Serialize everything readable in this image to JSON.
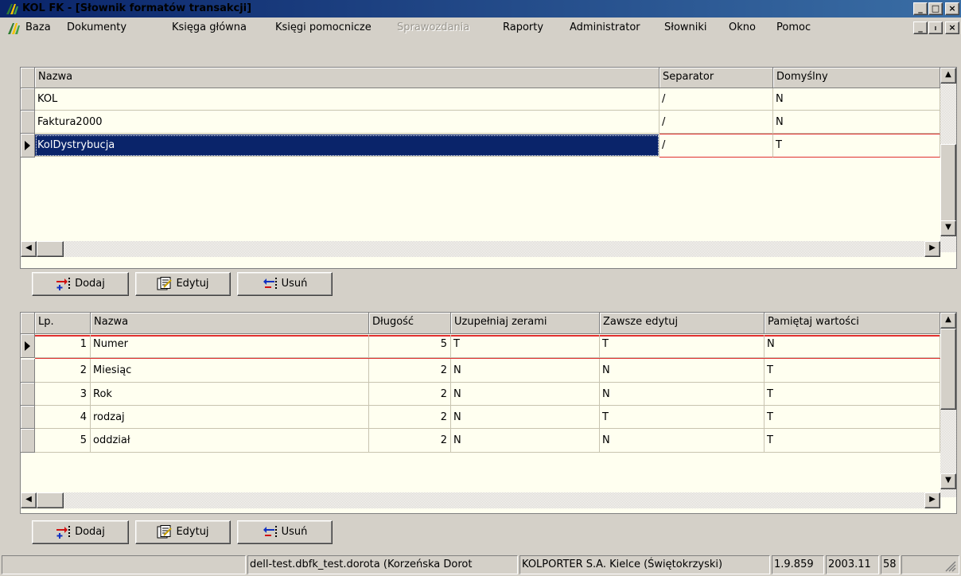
{
  "window": {
    "title": "KOL FK - [Słownik formatów transakcji]",
    "minimize": "_",
    "restore": "□",
    "close": "×"
  },
  "mdi": {
    "minimize": "_",
    "restore": "ₗ",
    "close": "×"
  },
  "menu": [
    {
      "label": "Baza",
      "enabled": true
    },
    {
      "label": "Dokumenty",
      "enabled": true
    },
    {
      "label": "Księga główna",
      "enabled": true
    },
    {
      "label": "Księgi pomocnicze",
      "enabled": true
    },
    {
      "label": "Sprawozdania",
      "enabled": false
    },
    {
      "label": "Raporty",
      "enabled": true
    },
    {
      "label": "Administrator",
      "enabled": true
    },
    {
      "label": "Słowniki",
      "enabled": true
    },
    {
      "label": "Okno",
      "enabled": true
    },
    {
      "label": "Pomoc",
      "enabled": true
    }
  ],
  "formats": {
    "columns": [
      "Nazwa",
      "Separator",
      "Domyślny"
    ],
    "rows": [
      [
        "KOL",
        "/",
        "N"
      ],
      [
        "Faktura2000",
        "/",
        "N"
      ],
      [
        "KolDystrybucja",
        "/",
        "T"
      ]
    ],
    "selected_row": 2
  },
  "fields": {
    "columns": [
      "Lp.",
      "Nazwa",
      "Długość",
      "Uzupełniaj zerami",
      "Zawsze edytuj",
      "Pamiętaj wartości"
    ],
    "rows": [
      [
        "1",
        "Numer",
        "5",
        "T",
        "T",
        "N"
      ],
      [
        "2",
        "Miesiąc",
        "2",
        "N",
        "N",
        "T"
      ],
      [
        "3",
        "Rok",
        "2",
        "N",
        "N",
        "T"
      ],
      [
        "4",
        "rodzaj",
        "2",
        "N",
        "T",
        "T"
      ],
      [
        "5",
        "oddział",
        "2",
        "N",
        "N",
        "T"
      ]
    ],
    "current_row": 0
  },
  "buttons": {
    "add": "Dodaj",
    "edit": "Edytuj",
    "remove": "Usuń"
  },
  "status": {
    "empty": "",
    "connection": "dell-test.dbfk_test.dorota (Korzeńska Dorot",
    "company": "KOLPORTER S.A. Kielce (Świętokrzyski)",
    "version": "1.9.859",
    "period": "2003.11",
    "number": "58"
  },
  "colors": {
    "title_bar": "#0a246a",
    "grid_background": "#fffff0",
    "selection": "#0a246a",
    "current_row_border": "#e03030"
  }
}
